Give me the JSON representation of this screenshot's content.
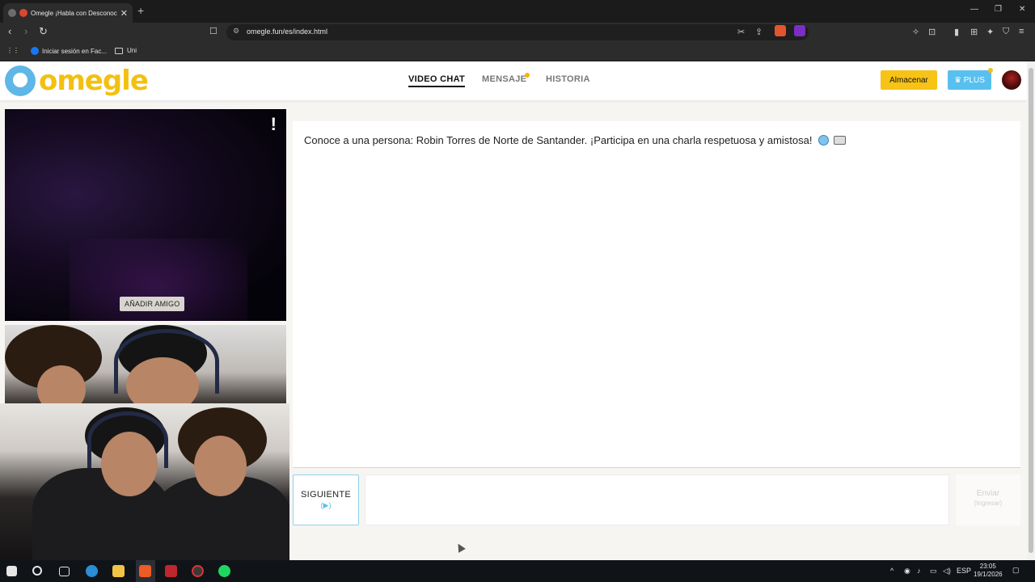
{
  "browser": {
    "tab_title": "Omegle ¡Habla con Desconocidos!",
    "tab_close": "✕",
    "new_tab": "+",
    "url": "omegle.fun/es/index.html",
    "bookmarks": [
      {
        "label": "Iniciar sesión en Fac..."
      },
      {
        "label": "Uni"
      }
    ]
  },
  "header": {
    "logo_text": "omegle",
    "nav": [
      {
        "label": "VIDEO CHAT",
        "active": true
      },
      {
        "label": "MENSAJE"
      },
      {
        "label": "HISTORIA"
      }
    ],
    "store_label": "Almacenar",
    "plus_label": "♛ PLUS"
  },
  "video": {
    "report_label": "!",
    "add_friend_label": "AÑADIR AMIGO"
  },
  "chat": {
    "intro": "Conoce a una persona: Robin Torres de Norte de Santander. ¡Participa en una charla respetuosa y amistosa!"
  },
  "controls": {
    "next_label": "SIGUIENTE",
    "next_hint": "(▶)",
    "send_label": "Enviar",
    "send_hint": "(Ingresar)"
  },
  "taskbar": {
    "lang": "ESP",
    "time": "23:05",
    "date": "19/1/2026"
  },
  "colors": {
    "accent_yellow": "#f7c317",
    "accent_blue": "#58c0ef",
    "logo_blue": "#5eb7e6"
  }
}
